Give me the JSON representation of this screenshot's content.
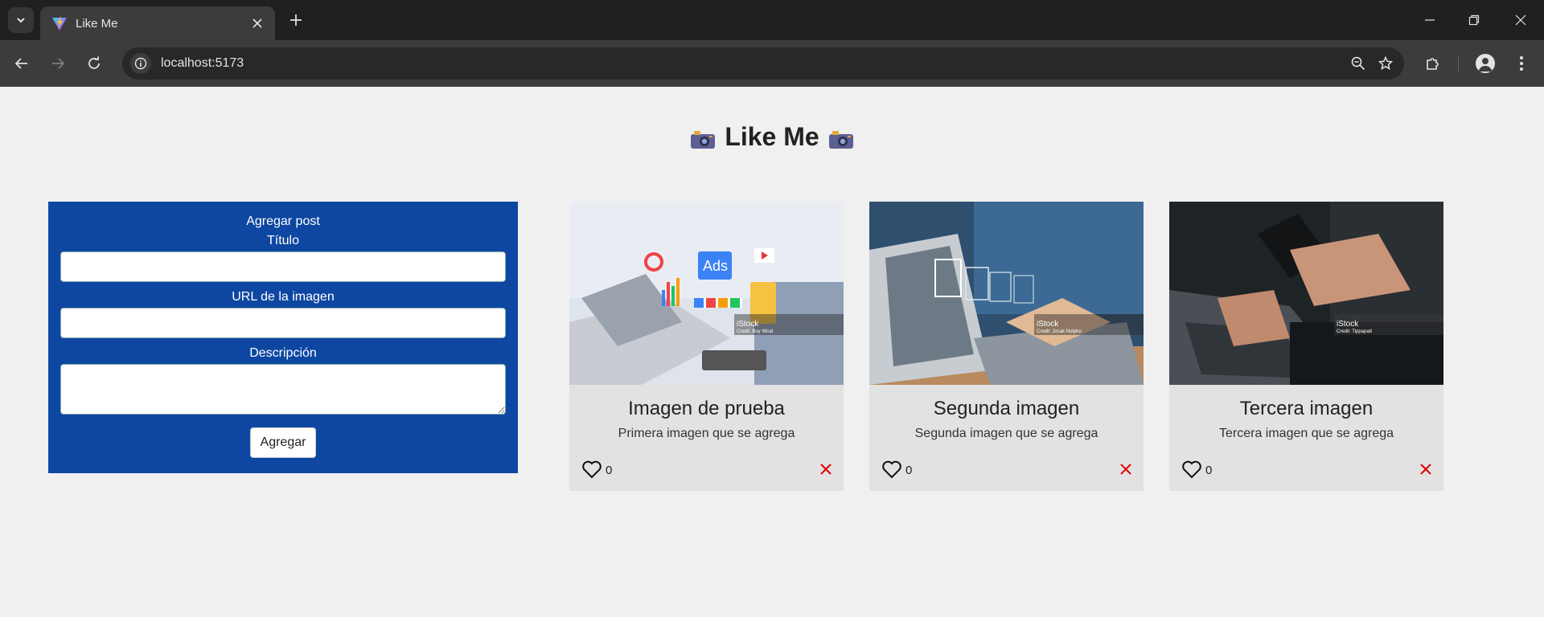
{
  "browser": {
    "tab_title": "Like Me",
    "url": "localhost:5173"
  },
  "page": {
    "title": "Like Me"
  },
  "form": {
    "heading": "Agregar post",
    "title_label": "Título",
    "title_value": "",
    "image_url_label": "URL de la imagen",
    "image_url_value": "",
    "description_label": "Descripción",
    "description_value": "",
    "submit_label": "Agregar"
  },
  "posts": [
    {
      "title": "Imagen de prueba",
      "description": "Primera imagen que se agrega",
      "likes": "0"
    },
    {
      "title": "Segunda imagen",
      "description": "Segunda imagen que se agrega",
      "likes": "0"
    },
    {
      "title": "Tercera imagen",
      "description": "Tercera imagen que se agrega",
      "likes": "0"
    }
  ],
  "colors": {
    "form_background": "#0d47a1",
    "page_background": "#f0f0f0",
    "card_background": "#e2e2e2",
    "delete_icon": "#e00000"
  },
  "icons": [
    "tab-search-icon",
    "vite-favicon-icon",
    "close-icon",
    "plus-icon",
    "minimize-icon",
    "restore-icon",
    "back-icon",
    "forward-icon",
    "reload-icon",
    "info-icon",
    "zoom-icon",
    "star-icon",
    "extensions-icon",
    "profile-icon",
    "menu-icon",
    "camera-icon",
    "heart-icon",
    "delete-icon"
  ]
}
